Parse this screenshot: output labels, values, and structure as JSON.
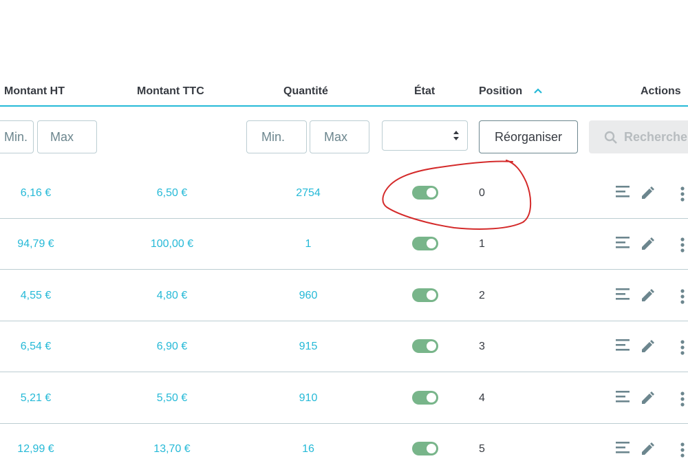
{
  "table": {
    "headers": {
      "montant_ht": "Montant HT",
      "montant_ttc": "Montant TTC",
      "quantite": "Quantité",
      "etat": "État",
      "position": "Position",
      "actions": "Actions"
    },
    "sort_indicator": "position ascending",
    "filters": {
      "ht_min_placeholder": "Min.",
      "ht_max_placeholder": "Max",
      "qty_min_placeholder": "Min.",
      "qty_max_placeholder": "Max",
      "etat_selected": "",
      "reorganize_label": "Réorganiser",
      "search_label": "Rechercher"
    },
    "rows": [
      {
        "ht": "6,16 €",
        "ttc": "6,50 €",
        "qty": "2754",
        "enabled": true,
        "position": "0"
      },
      {
        "ht": "94,79 €",
        "ttc": "100,00 €",
        "qty": "1",
        "enabled": true,
        "position": "1"
      },
      {
        "ht": "4,55 €",
        "ttc": "4,80 €",
        "qty": "960",
        "enabled": true,
        "position": "2"
      },
      {
        "ht": "6,54 €",
        "ttc": "6,90 €",
        "qty": "915",
        "enabled": true,
        "position": "3"
      },
      {
        "ht": "5,21 €",
        "ttc": "5,50 €",
        "qty": "910",
        "enabled": true,
        "position": "4"
      },
      {
        "ht": "12,99 €",
        "ttc": "13,70 €",
        "qty": "16",
        "enabled": true,
        "position": "5"
      }
    ],
    "row_icons": [
      "list-icon",
      "pencil-icon",
      "more-vertical-icon"
    ]
  },
  "annotation": {
    "color": "#d42a2a"
  },
  "colors": {
    "accent": "#25b9d7",
    "toggle_on": "#78b58a",
    "border": "#bbcdd2"
  }
}
